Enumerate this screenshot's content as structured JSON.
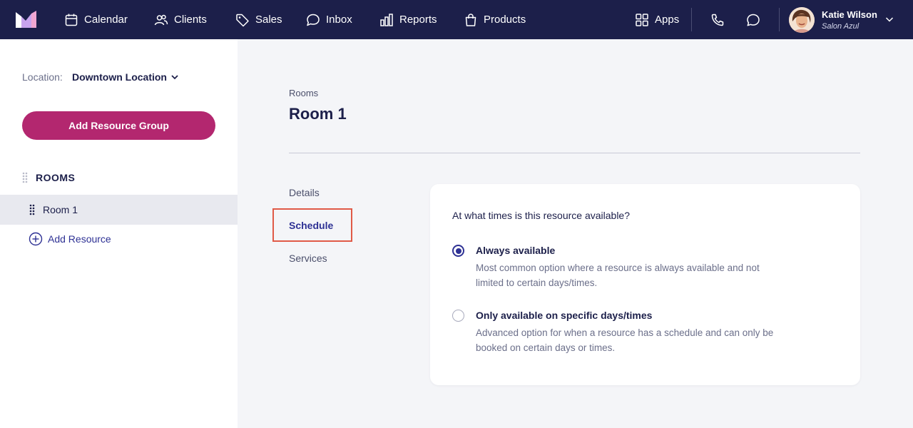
{
  "nav": {
    "items": [
      {
        "label": "Calendar",
        "icon": "calendar-icon"
      },
      {
        "label": "Clients",
        "icon": "clients-icon"
      },
      {
        "label": "Sales",
        "icon": "tag-icon"
      },
      {
        "label": "Inbox",
        "icon": "inbox-icon"
      },
      {
        "label": "Reports",
        "icon": "bar-chart-icon"
      },
      {
        "label": "Products",
        "icon": "shopping-bag-icon"
      }
    ],
    "apps_label": "Apps",
    "user": {
      "name": "Katie Wilson",
      "business": "Salon Azul"
    }
  },
  "sidebar": {
    "location_label": "Location:",
    "location_value": "Downtown Location",
    "add_group_label": "Add Resource Group",
    "group_title": "ROOMS",
    "rooms": [
      {
        "label": "Room 1",
        "selected": true
      }
    ],
    "add_resource_label": "Add Resource"
  },
  "main": {
    "breadcrumb": "Rooms",
    "title": "Room 1",
    "tabs": [
      {
        "label": "Details",
        "active": false
      },
      {
        "label": "Schedule",
        "active": true
      },
      {
        "label": "Services",
        "active": false
      }
    ],
    "card": {
      "question": "At what times is this resource available?",
      "options": [
        {
          "title": "Always available",
          "desc_line1": "Most common option where a resource is always available and not",
          "desc_line2": "limited to certain days/times.",
          "selected": true
        },
        {
          "title": "Only available on specific days/times",
          "desc_line1": "Advanced option for when a resource has a schedule and can only be",
          "desc_line2": "booked on certain days or times.",
          "selected": false
        }
      ]
    }
  },
  "colors": {
    "nav_bg": "#1c1f4a",
    "accent": "#b3276f",
    "link": "#2e3194",
    "highlight": "#e05a47"
  }
}
